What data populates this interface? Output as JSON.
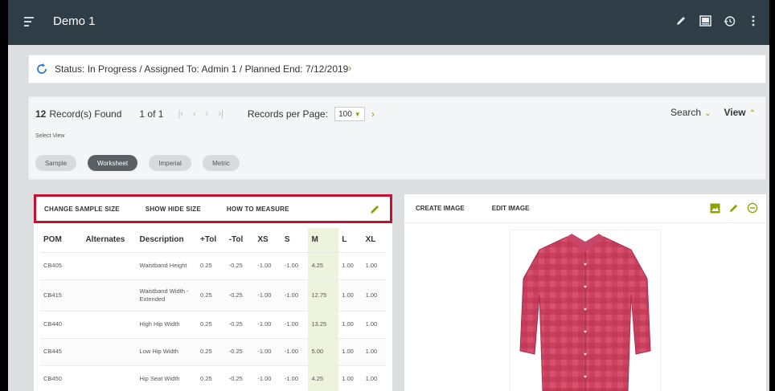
{
  "app": {
    "title": "Demo 1",
    "actions": [
      "pencil-icon",
      "image-icon",
      "history-icon",
      "more-vert-icon"
    ]
  },
  "status": {
    "text": "Status: In Progress / Assigned To: Admin 1 / Planned End: 7/12/2019",
    "chevron": "›"
  },
  "records": {
    "count": "12",
    "found_label": "Record(s) Found",
    "page": "1 of 1",
    "pager": [
      "|‹",
      "‹",
      "›",
      "›|"
    ],
    "per_page_label": "Records per Page:",
    "per_page_value": "100",
    "search_label": "Search",
    "view_label": "View",
    "select_view_label": "Select View",
    "views": [
      {
        "label": "Sample",
        "active": false
      },
      {
        "label": "Worksheet",
        "active": true
      },
      {
        "label": "Imperial",
        "active": false
      },
      {
        "label": "Metric",
        "active": false
      }
    ]
  },
  "table_toolbar": {
    "tabs": [
      "CHANGE SAMPLE SIZE",
      "SHOW HIDE SIZE",
      "HOW TO MEASURE"
    ]
  },
  "table": {
    "headers": [
      "POM",
      "Alternates",
      "Description",
      "+Tol",
      "-Tol",
      "XS",
      "S",
      "M",
      "L",
      "XL"
    ],
    "rows": [
      [
        "CB405",
        "",
        "Waistband Height",
        "0.25",
        "-0.25",
        "-1.00",
        "-1.00",
        "4.25",
        "1.00",
        "1.00"
      ],
      [
        "CB415",
        "",
        "Waistband Width - Extended",
        "0.25",
        "-0.25",
        "-1.00",
        "-1.00",
        "12.75",
        "1.00",
        "1.00"
      ],
      [
        "CB440",
        "",
        "High Hip Width",
        "0.25",
        "-0.25",
        "-1.00",
        "-1.00",
        "13.25",
        "1.00",
        "1.00"
      ],
      [
        "CB445",
        "",
        "Low Hip Width",
        "0.25",
        "-0.25",
        "-1.00",
        "-1.00",
        "5.00",
        "1.00",
        "1.00"
      ],
      [
        "CB450",
        "",
        "Hip Seat Width",
        "0.25",
        "-0.25",
        "-1.00",
        "-1.00",
        "4.25",
        "1.00",
        "1.00"
      ]
    ]
  },
  "image_toolbar": {
    "tabs": [
      "CREATE IMAGE",
      "EDIT IMAGE"
    ],
    "actions": [
      "image-icon",
      "pencil-icon",
      "remove-circle-icon"
    ]
  },
  "colors": {
    "topbar": "#2f3d47",
    "accent_green": "#8da000",
    "highlight_red": "#c8102e",
    "shirt_pink": "#d94a6e"
  }
}
